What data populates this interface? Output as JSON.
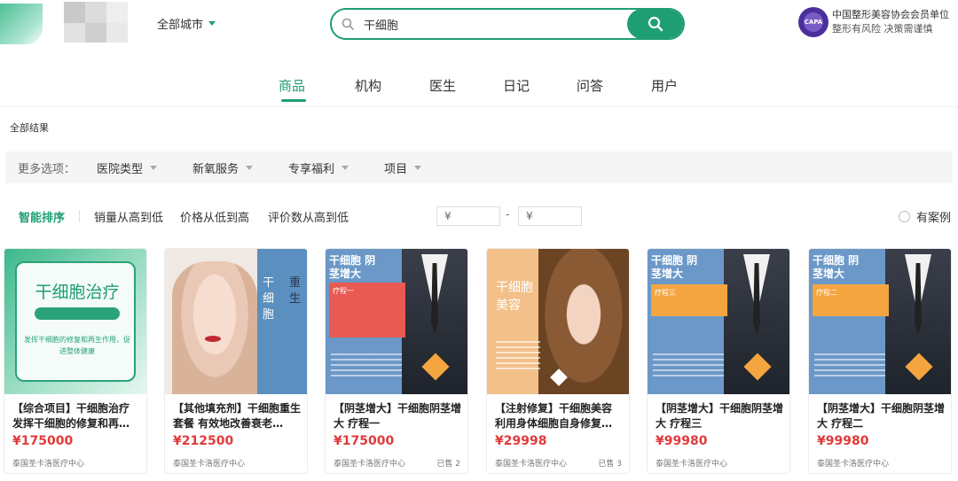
{
  "header": {
    "city_label": "全部城市",
    "search_value": "干细胞",
    "assoc_emblem": "CAPA",
    "assoc_line1": "中国整形美容协会会员单位",
    "assoc_line2": "整形有风险 决策需谨慎"
  },
  "tabs": [
    "商品",
    "机构",
    "医生",
    "日记",
    "问答",
    "用户"
  ],
  "active_tab": "商品",
  "results_label": "全部结果",
  "filters": {
    "label": "更多选项：",
    "options": [
      "医院类型",
      "新氧服务",
      "专享福利",
      "项目"
    ]
  },
  "sort": {
    "items": [
      "智能排序",
      "销量从高到低",
      "价格从低到高",
      "评价数从高到低"
    ],
    "active": "智能排序",
    "price_min_placeholder": "¥",
    "price_max_placeholder": "¥",
    "price_dash": "-",
    "has_case_label": "有案例"
  },
  "products": [
    {
      "title": "【综合项目】干细胞治疗 发挥干细胞的修复和再…",
      "price": "¥175000",
      "clinic": "泰国圣卡洛医疗中心",
      "sold": "",
      "image_text": "干细胞治疗",
      "image_subtext": "发挥干细胞的修复和再生作用，促进整体健康"
    },
    {
      "title": "【其他填充剂】干细胞重生套餐 有效地改善衰老…",
      "price": "¥212500",
      "clinic": "泰国圣卡洛医疗中心",
      "sold": "",
      "image_text": "干细胞",
      "image_subtext": "重生"
    },
    {
      "title": "【阴茎增大】干细胞阴茎增大 疗程一",
      "price": "¥175000",
      "clinic": "泰国圣卡洛医疗中心",
      "sold": "已售 2",
      "image_text": "干细胞 阴茎增大",
      "image_subtext": "疗程一"
    },
    {
      "title": "【注射修复】干细胞美容 利用身体细胞自身修复…",
      "price": "¥29998",
      "clinic": "泰国圣卡洛医疗中心",
      "sold": "已售 3",
      "image_text": "干细胞美容",
      "image_subtext": ""
    },
    {
      "title": "【阴茎增大】干细胞阴茎增大 疗程三",
      "price": "¥99980",
      "clinic": "泰国圣卡洛医疗中心",
      "sold": "",
      "image_text": "干细胞 阴茎增大",
      "image_subtext": "疗程三"
    },
    {
      "title": "【阴茎增大】干细胞阴茎增大 疗程二",
      "price": "¥99980",
      "clinic": "泰国圣卡洛医疗中心",
      "sold": "",
      "image_text": "干细胞 阴茎增大",
      "image_subtext": "疗程二"
    }
  ],
  "colors": {
    "brand": "#1f9e74",
    "price": "#e03a3a"
  }
}
